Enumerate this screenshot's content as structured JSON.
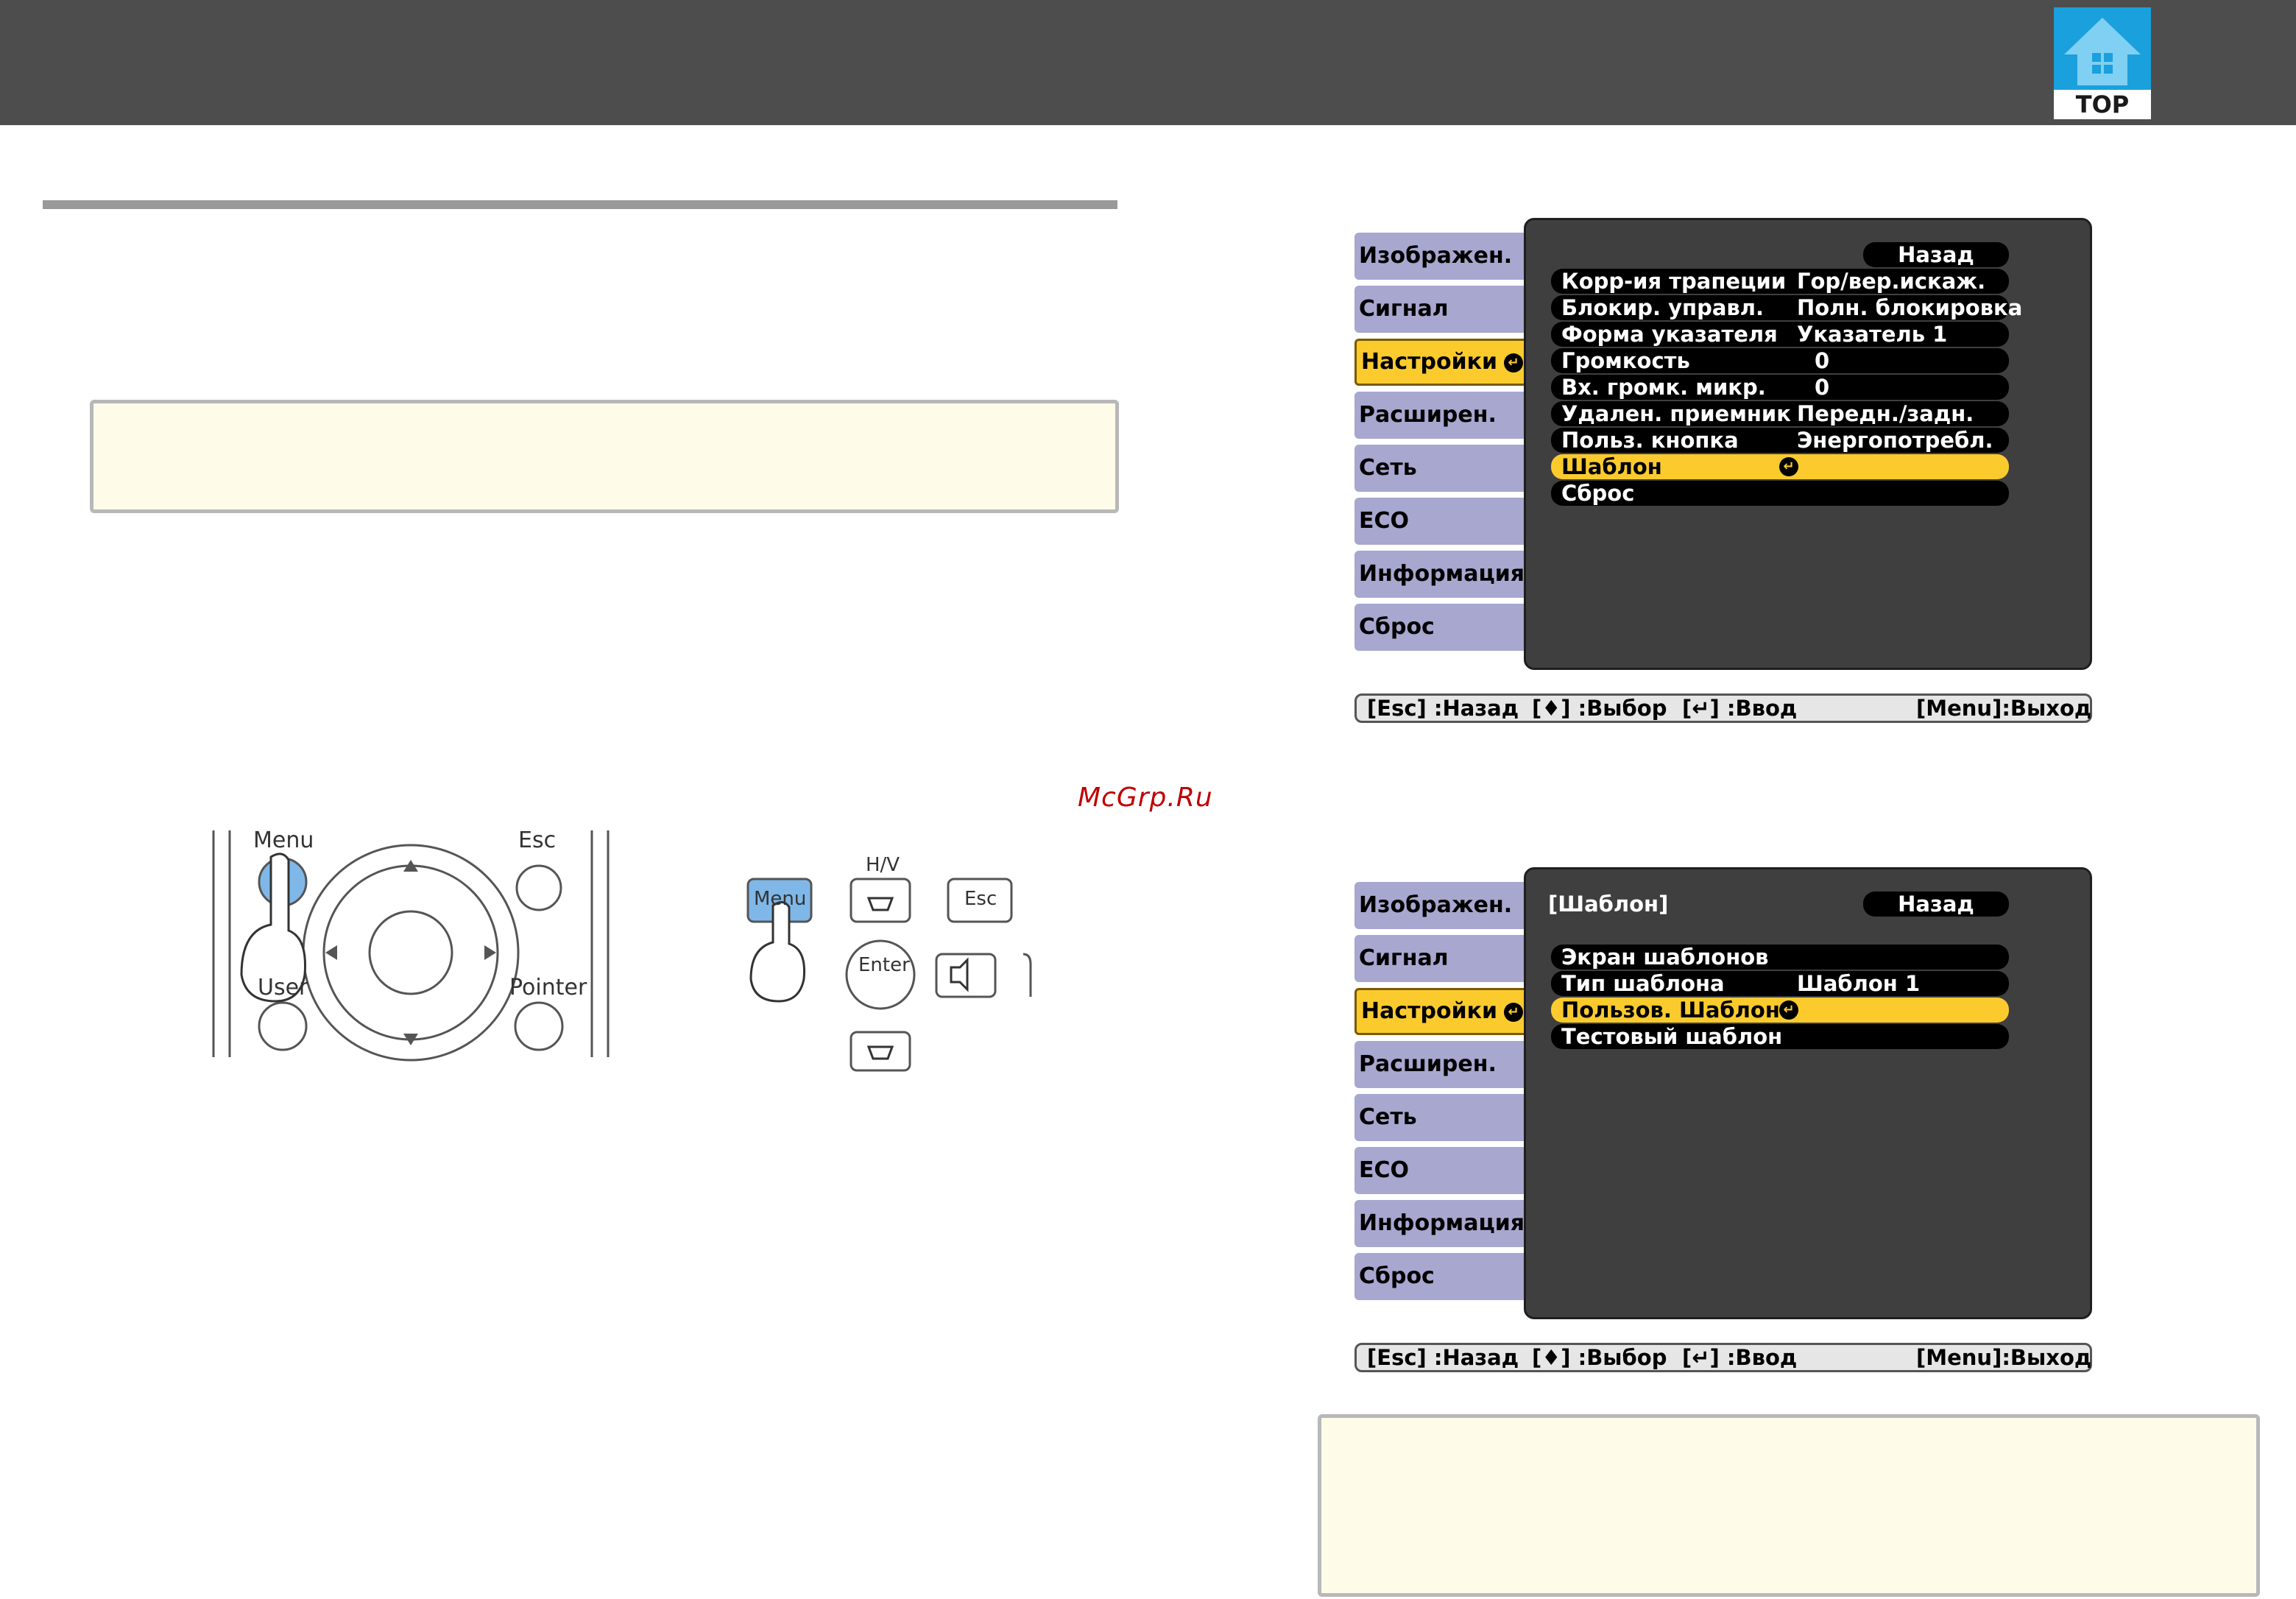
{
  "header": {
    "logo_text": "TOP",
    "logo_icon": "house-icon",
    "colors": {
      "bar": "#4d4d4d",
      "logo": "#1aa0dc"
    }
  },
  "watermark": "McGrp.Ru",
  "remote": {
    "menu": "Menu",
    "esc": "Esc",
    "user": "User",
    "pointer": "Pointer"
  },
  "control_panel": {
    "hv": "H/V",
    "menu": "Menu",
    "esc": "Esc",
    "enter": "Enter"
  },
  "menu_common": {
    "tabs": [
      "Изображен.",
      "Сигнал",
      "Настройки",
      "Расширен.",
      "Сеть",
      "ECO",
      "Информация",
      "Сброс"
    ],
    "active_tab": "Настройки",
    "back": "Назад",
    "status": {
      "esc": "[Esc] :Назад",
      "select": "[♦] :Выбор",
      "enter": "[↵] :Ввод",
      "menu": "[Menu]:Выход"
    },
    "colors": {
      "tab": "#a7a7cf",
      "active": "#fbcb2e",
      "panel": "#3f3f3f"
    }
  },
  "menu1": {
    "items": [
      {
        "label": "Корр-ия трапеции",
        "value": "Гор/вер.искаж."
      },
      {
        "label": "Блокир. управл.",
        "value": "Полн. блокировка"
      },
      {
        "label": "Форма указателя",
        "value": "Указатель 1"
      },
      {
        "label": "Громкость",
        "value": "0"
      },
      {
        "label": "Вх. громк. микр.",
        "value": "0"
      },
      {
        "label": "Удален. приемник",
        "value": "Передн./задн."
      },
      {
        "label": "Польз. кнопка",
        "value": "Энергопотребл."
      },
      {
        "label": "Шаблон",
        "value": ""
      },
      {
        "label": "Сброс",
        "value": ""
      }
    ],
    "selected": "Шаблон"
  },
  "menu2": {
    "heading": "[Шаблон]",
    "items": [
      {
        "label": "Экран шаблонов",
        "value": ""
      },
      {
        "label": "Тип шаблона",
        "value": "Шаблон 1"
      },
      {
        "label": "Пользов. Шаблон",
        "value": ""
      },
      {
        "label": "Тестовый шаблон",
        "value": ""
      }
    ],
    "selected": "Пользов. Шаблон"
  }
}
